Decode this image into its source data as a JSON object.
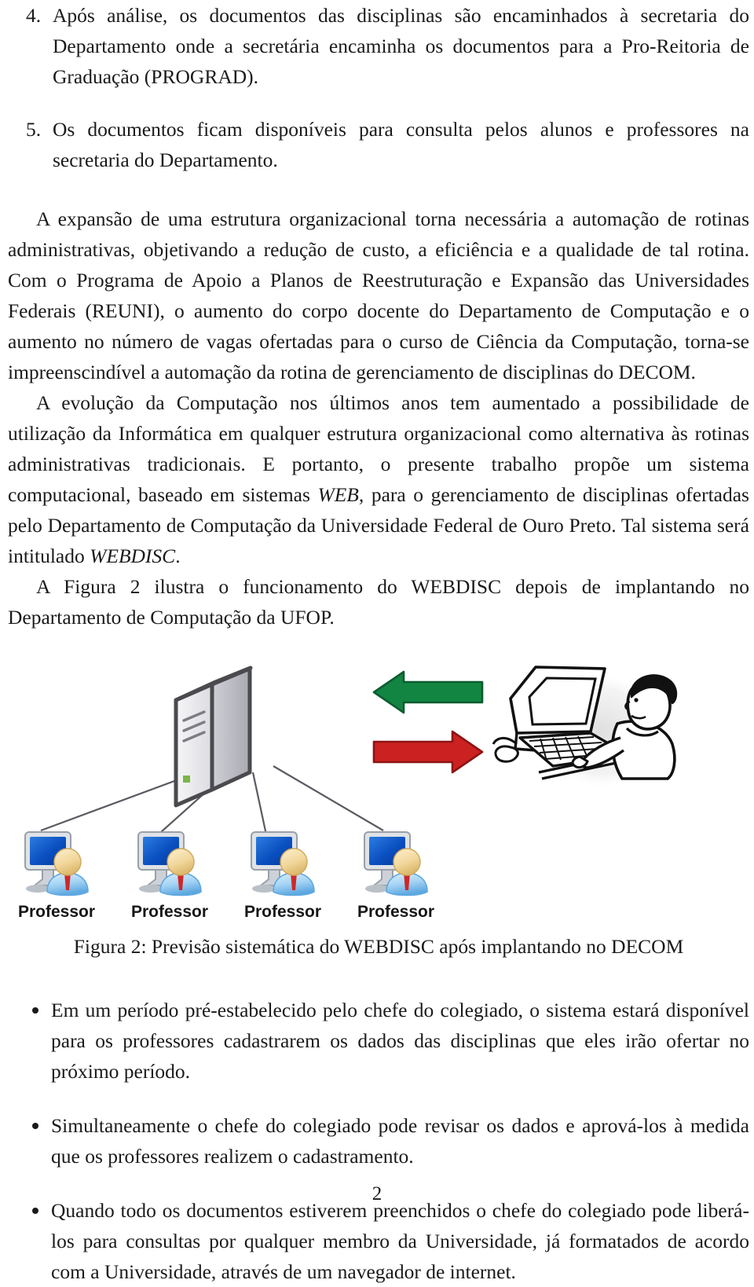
{
  "document": {
    "page_number": "2",
    "numbered_list": [
      {
        "marker": "4.",
        "text": "Após análise, os documentos das disciplinas são encaminhados à secretaria do Departamento onde a secretária encaminha os documentos para a Pro-Reitoria de Graduação (PROGRAD)."
      },
      {
        "marker": "5.",
        "text": "Os documentos ficam disponíveis para consulta pelos alunos e professores na secretaria do Departamento."
      }
    ],
    "paragraphs": [
      {
        "id": "p1",
        "text": "A expansão de uma estrutura organizacional torna necessária a automação de rotinas administrativas, objetivando a redução de custo, a eficiência e a qualidade de tal rotina. Com o Programa de Apoio a Planos de Reestruturação e Expansão das Universidades Federais (REUNI), o aumento do corpo docente do Departamento de Computação e o aumento no número de vagas ofertadas para o curso de Ciência da Computação, torna-se impreenscindível a automação da rotina de gerenciamento de disciplinas do DECOM."
      },
      {
        "id": "p2_part1",
        "text": "A evolução da Computação nos últimos anos tem aumentado a possibilidade de utilização da Informática em qualquer estrutura organizacional como alternativa às rotinas administrativas tradicionais. E portanto, o presente trabalho propõe um sistema computacional, baseado em sistemas "
      },
      {
        "id": "p2_em1",
        "text": "WEB"
      },
      {
        "id": "p2_part2",
        "text": ", para o gerenciamento de disciplinas ofertadas pelo Departamento de Computação da Universidade Federal de Ouro Preto. Tal sistema será intitulado "
      },
      {
        "id": "p2_em2",
        "text": "WEBDISC"
      },
      {
        "id": "p2_part3",
        "text": "."
      },
      {
        "id": "p3",
        "text": "A Figura 2 ilustra o funcionamento do WEBDISC depois de implantando no Departamento de Computação da UFOP."
      }
    ],
    "figure": {
      "caption": "Figura 2: Previsão sistemática do WEBDISC após implantando no DECOM",
      "client_labels": [
        "Professor",
        "Professor",
        "Professor",
        "Professor"
      ],
      "arrows": [
        {
          "name": "arrow-left-green",
          "direction": "left",
          "color": "#128543"
        },
        {
          "name": "arrow-right-red",
          "direction": "right",
          "color": "#cc2121"
        }
      ],
      "nodes": [
        {
          "name": "server-tower",
          "kind": "server"
        },
        {
          "name": "user-at-computer",
          "kind": "person-illustration"
        }
      ],
      "colors": {
        "server_face": "#e9e9ec",
        "server_side": "#bfc0c6",
        "server_outline": "#4a4a4f",
        "monitor_screen": "#0a51c4",
        "avatar_head": "#f4dba4",
        "avatar_body": "#9fd0f2",
        "avatar_tie": "#cf2727",
        "connector_line": "#5a5a62",
        "arrow_green": "#128543",
        "arrow_red": "#cc2121"
      }
    },
    "bullet_list": [
      {
        "text": "Em um período pré-estabelecido pelo chefe do colegiado, o sistema estará disponível para os professores cadastrarem os dados das disciplinas que eles irão ofertar no próximo período."
      },
      {
        "text": "Simultaneamente o chefe do colegiado pode revisar os dados e aprová-los à medida que os professores realizem o cadastramento."
      },
      {
        "text": "Quando todo os documentos estiverem preenchidos o chefe do colegiado pode liberá-los para consultas por qualquer membro da Universidade, já formatados de acordo com a Universidade, através de um navegador de internet."
      }
    ]
  }
}
